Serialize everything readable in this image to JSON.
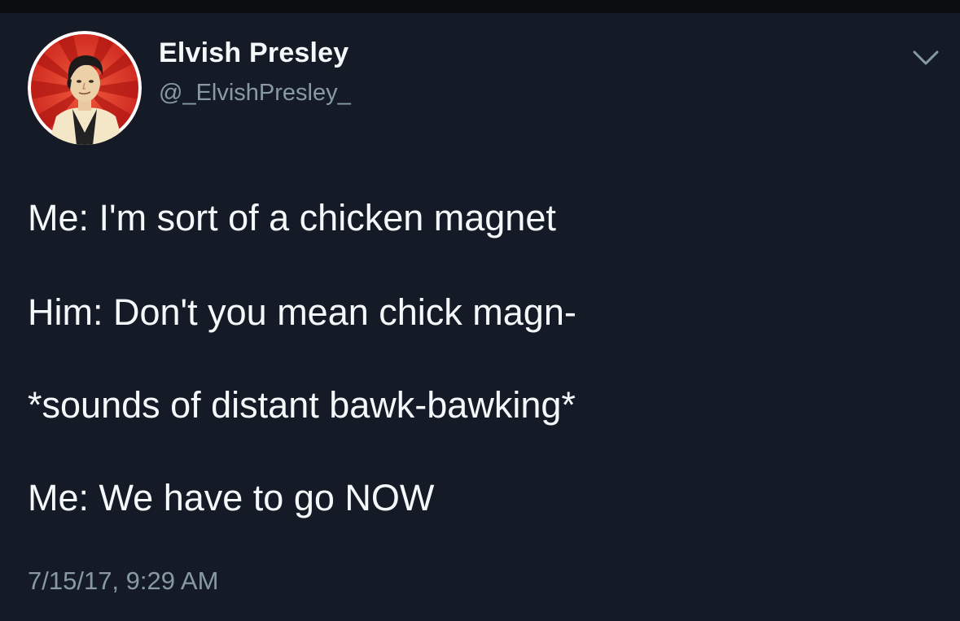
{
  "tweet": {
    "author": {
      "display_name": "Elvish Presley",
      "handle": "@_ElvishPresley_",
      "avatar_icon": "elvis-portrait-avatar"
    },
    "menu_icon": "chevron-down-icon",
    "lines": [
      "Me: I'm sort of a chicken magnet",
      "Him: Don't you mean chick magn-",
      "*sounds of distant bawk-bawking*",
      "Me: We have to go NOW"
    ],
    "timestamp": "7/15/17, 9:29 AM"
  },
  "colors": {
    "background": "#151b26",
    "primary_text": "#f5f8fa",
    "secondary_text": "#8899a6",
    "avatar_red": "#d8281e"
  }
}
